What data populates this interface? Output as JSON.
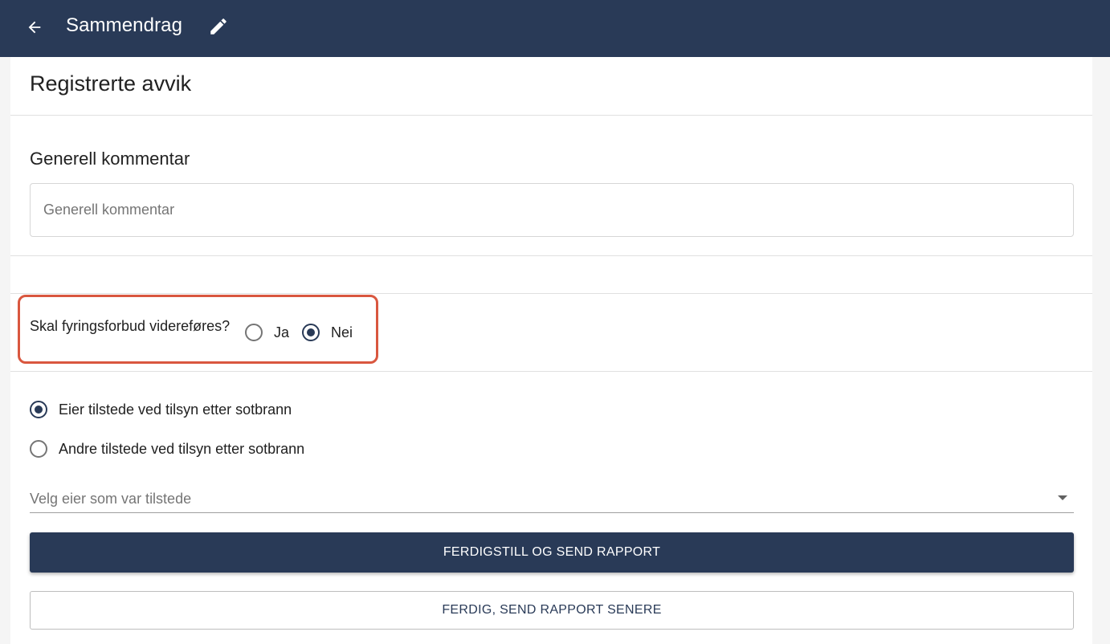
{
  "header": {
    "back_icon": "arrow-left-icon",
    "title": "Sammendrag",
    "edit_icon": "pencil-icon",
    "background_color": "#293a57"
  },
  "registered": {
    "title": "Registrerte avvik"
  },
  "general_comment": {
    "title": "Generell kommentar",
    "value": "",
    "placeholder": "Generell kommentar"
  },
  "fire_ban": {
    "question": "Skal fyringsforbud videreføres?",
    "options": [
      {
        "label": "Ja",
        "checked": false
      },
      {
        "label": "Nei",
        "checked": true
      }
    ],
    "highlight_color": "#d9573f"
  },
  "presence": {
    "options": [
      {
        "label": "Eier tilstede ved tilsyn etter sotbrann",
        "checked": true
      },
      {
        "label": "Andre tilstede ved tilsyn etter sotbrann",
        "checked": false
      }
    ]
  },
  "owner_select": {
    "placeholder": "Velg eier som var tilstede",
    "selected": ""
  },
  "actions": {
    "primary_label": "FERDIGSTILL OG SEND RAPPORT",
    "secondary_label": "FERDIG, SEND RAPPORT SENERE"
  }
}
